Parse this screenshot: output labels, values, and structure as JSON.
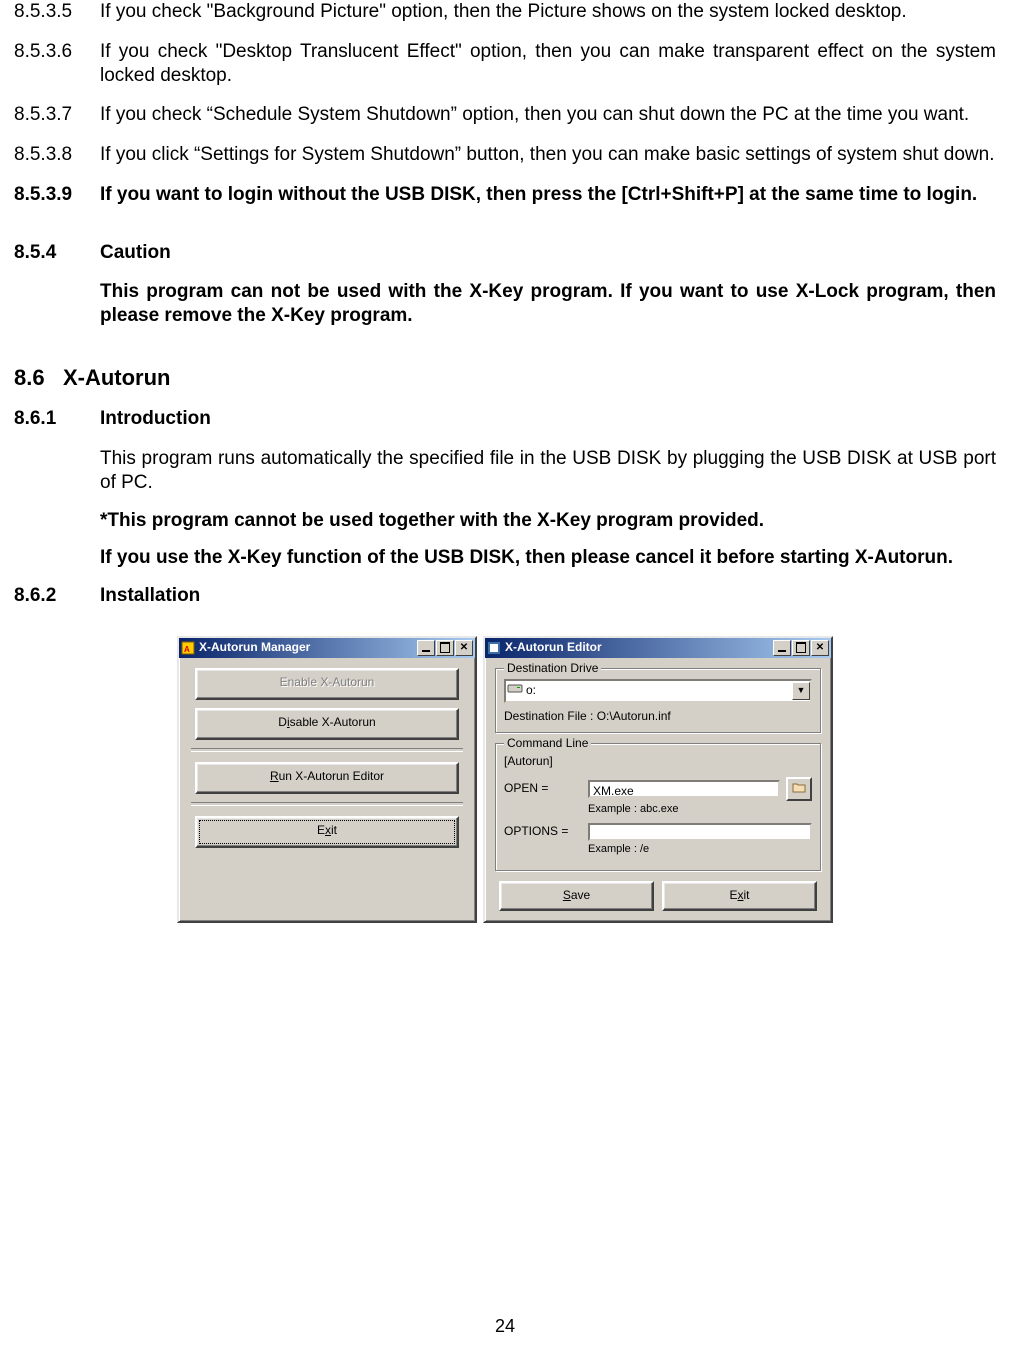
{
  "items": [
    {
      "num": "8.5.3.5",
      "bold": false,
      "text": "If you check \"Background Picture\" option, then the Picture shows on the system locked desktop."
    },
    {
      "num": "8.5.3.6",
      "bold": false,
      "text": "If you check \"Desktop Translucent Effect\" option, then you can make transparent effect on the system locked desktop."
    },
    {
      "num": "8.5.3.7",
      "bold": false,
      "text": "If you check “Schedule System Shutdown” option, then you can shut down the PC at the time you want."
    },
    {
      "num": "8.5.3.8",
      "bold": false,
      "text": "If you click “Settings for System Shutdown” button, then you can make basic settings of system shut down."
    },
    {
      "num": "8.5.3.9",
      "bold": true,
      "text": "If you want to login without the USB DISK, then press the [Ctrl+Shift+P] at the same time to login."
    }
  ],
  "caution": {
    "num": "8.5.4",
    "head": "Caution",
    "text": "This program can not be used with the X-Key program. If you want to use X-Lock program, then please remove the X-Key program."
  },
  "section86": {
    "num": "8.6",
    "title": "X-Autorun"
  },
  "sub861": {
    "num": "8.6.1",
    "head": "Introduction",
    "p1": "This program runs automatically the specified file in the USB DISK by plugging the USB DISK at USB port of PC.",
    "p2": "*This program cannot be used together with the X-Key program provided.",
    "p3": "If you use the X-Key function of the USB DISK, then please cancel it before starting X-Autorun."
  },
  "sub862": {
    "num": "8.6.2",
    "head": "Installation"
  },
  "manager": {
    "title": "X-Autorun Manager",
    "enable": "Enable X-Autorun",
    "disable_pre": "D",
    "disable_u": "i",
    "disable_post": "sable X-Autorun",
    "run_u": "R",
    "run_post": "un X-Autorun Editor",
    "exit_pre": "E",
    "exit_u": "x",
    "exit_post": "it"
  },
  "editor": {
    "title": "X-Autorun Editor",
    "grp_dest": "Destination Drive",
    "drive_text": "o:",
    "dest_file": "Destination File : O:\\Autorun.inf",
    "grp_cmd": "Command Line",
    "autorun": "[Autorun]",
    "open_label": "OPEN =",
    "open_value": "XM.exe",
    "open_example": "Example : abc.exe",
    "options_label": "OPTIONS =",
    "options_value": "",
    "options_example": "Example : /e",
    "save_u": "S",
    "save_post": "ave",
    "exit_pre": "E",
    "exit_u": "x",
    "exit_post": "it"
  },
  "page_number": "24"
}
